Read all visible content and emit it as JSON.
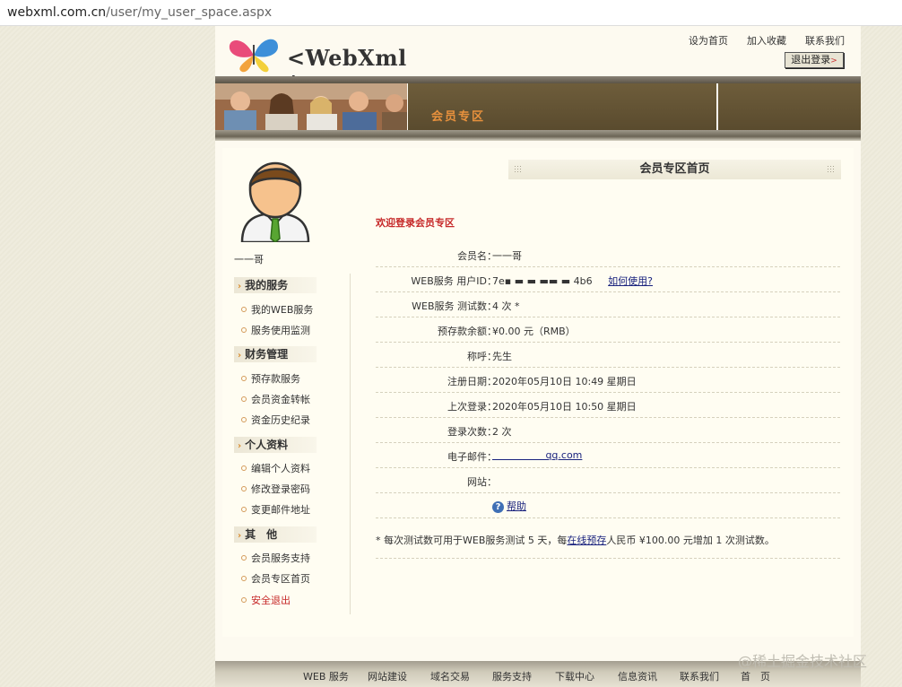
{
  "browser": {
    "url_domain": "webxml.com.cn",
    "url_path": "/user/my_user_space.aspx"
  },
  "header": {
    "logo_text": "<WebXml />",
    "links": [
      "设为首页",
      "加入收藏",
      "联系我们"
    ],
    "logout_button": "退出登录",
    "banner_title": "会员专区"
  },
  "sidebar": {
    "username": "一一哥",
    "sections": [
      {
        "title": "我的服务",
        "items": [
          "我的WEB服务",
          "服务使用监测"
        ]
      },
      {
        "title": "财务管理",
        "items": [
          "预存款服务",
          "会员资金转帐",
          "资金历史纪录"
        ]
      },
      {
        "title": "个人资料",
        "items": [
          "编辑个人资料",
          "修改登录密码",
          "变更邮件地址"
        ]
      },
      {
        "title": "其　他",
        "items": [
          "会员服务支持",
          "会员专区首页",
          "安全退出"
        ]
      }
    ]
  },
  "main": {
    "title": "会员专区首页",
    "welcome": "欢迎登录会员专区",
    "rows": [
      {
        "label": "会员名：",
        "value": "一一哥"
      },
      {
        "label": "WEB服务 用户ID：",
        "value": "7e▪ ▬          ▬  ▬▬  ▬    4b6",
        "link": "如何使用?"
      },
      {
        "label": "WEB服务 测试数：",
        "value": "4 次 *"
      },
      {
        "label": "预存款余额：",
        "value": "¥0.00 元（RMB）"
      },
      {
        "label": "称呼：",
        "value": "先生"
      },
      {
        "label": "注册日期：",
        "value": "2020年05月10日 10:49 星期日"
      },
      {
        "label": "上次登录：",
        "value": "2020年05月10日 10:50 星期日"
      },
      {
        "label": "登录次数：",
        "value": "2 次"
      },
      {
        "label": "电子邮件：",
        "value": "",
        "link": "                 qq.com"
      },
      {
        "label": "网站：",
        "value": ""
      }
    ],
    "help_label": "帮助",
    "note_before": "* 每次测试数可用于WEB服务测试 5 天，每",
    "note_link": "在线预存",
    "note_after": "人民币 ¥100.00 元增加 1 次测试数。"
  },
  "footer": {
    "links": [
      "WEB 服务",
      "网站建设",
      "域名交易",
      "服务支持",
      "下载中心",
      "信息资讯",
      "联系我们",
      "首　页"
    ]
  },
  "watermark": "@稀土掘金技术社区",
  "colors": {
    "accent_red": "#c62828",
    "banner_orange": "#e8913d",
    "link_blue": "#1a237e"
  }
}
